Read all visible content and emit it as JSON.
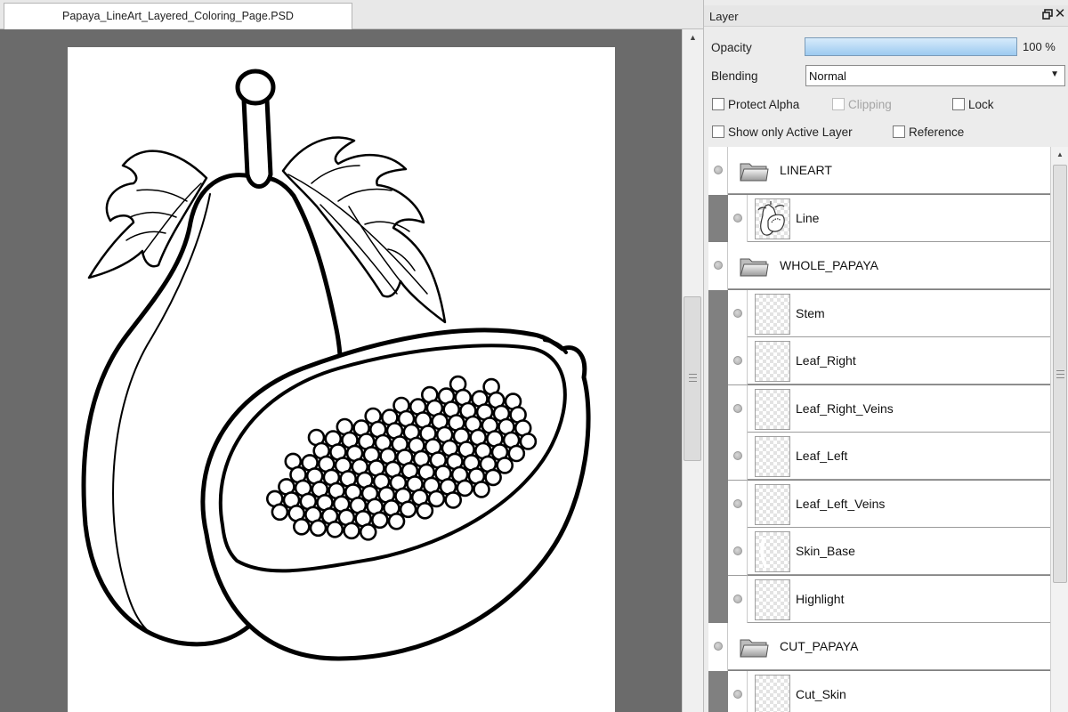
{
  "document": {
    "tab_title": "Papaya_LineArt_Layered_Coloring_Page.PSD"
  },
  "layer_panel": {
    "title": "Layer",
    "opacity": {
      "label": "Opacity",
      "value_text": "100 %",
      "level_percent": 100
    },
    "blending": {
      "label": "Blending",
      "selected": "Normal"
    },
    "options": {
      "protect_alpha": {
        "label": "Protect Alpha",
        "checked": false,
        "enabled": true
      },
      "clipping": {
        "label": "Clipping",
        "checked": false,
        "enabled": false
      },
      "lock": {
        "label": "Lock",
        "checked": false,
        "enabled": true
      },
      "show_only_active": {
        "label": "Show only Active Layer",
        "checked": false,
        "enabled": true
      },
      "reference": {
        "label": "Reference",
        "checked": false,
        "enabled": true
      }
    },
    "layers": [
      {
        "name": "LINEART",
        "type": "folder"
      },
      {
        "name": "Line",
        "type": "layer",
        "thumb": "lineart"
      },
      {
        "name": "WHOLE_PAPAYA",
        "type": "folder"
      },
      {
        "name": "Stem",
        "type": "layer",
        "thumb": "empty"
      },
      {
        "name": "Leaf_Right",
        "type": "layer",
        "thumb": "empty"
      },
      {
        "name": "Leaf_Right_Veins",
        "type": "layer",
        "thumb": "empty"
      },
      {
        "name": "Leaf_Left",
        "type": "layer",
        "thumb": "empty"
      },
      {
        "name": "Leaf_Left_Veins",
        "type": "layer",
        "thumb": "empty"
      },
      {
        "name": "Skin_Base",
        "type": "layer",
        "thumb": "skin"
      },
      {
        "name": "Highlight",
        "type": "layer",
        "thumb": "empty"
      },
      {
        "name": "CUT_PAPAYA",
        "type": "folder"
      },
      {
        "name": "Cut_Skin",
        "type": "layer",
        "thumb": "empty"
      }
    ]
  }
}
